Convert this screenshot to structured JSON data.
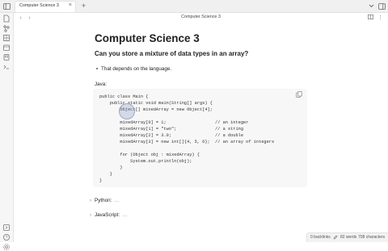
{
  "tab": {
    "title": "Computer Science 3",
    "close": "×",
    "new": "+"
  },
  "header": {
    "title": "Computer Science 3"
  },
  "note": {
    "h1": "Computer Science 3",
    "h2": "Can you store a mixture of data types in an array?",
    "bullet": "That depends on the language.",
    "java_label": "Java:",
    "code_lines": [
      "public class Main {",
      "    public static void main(String[] args) {",
      "        Object[] mixedArray = new Object[4];",
      "",
      "        mixedArray[0] = 1;                   // an integer",
      "        mixedArray[1] = \"two\";               // a string",
      "        mixedArray[2] = 3.0;                 // a double",
      "        mixedArray[3] = new int[]{4, 5, 6};  // an array of integers",
      "",
      "        for (Object obj : mixedArray) {",
      "            System.out.println(obj);",
      "        }",
      "    }",
      "}"
    ],
    "fold_python": "Python:",
    "fold_javascript": "JavaScript:",
    "ellipsis": "…"
  },
  "status": {
    "backlinks": "0 backlinks",
    "words": "82 words",
    "characters": "708 characters"
  }
}
